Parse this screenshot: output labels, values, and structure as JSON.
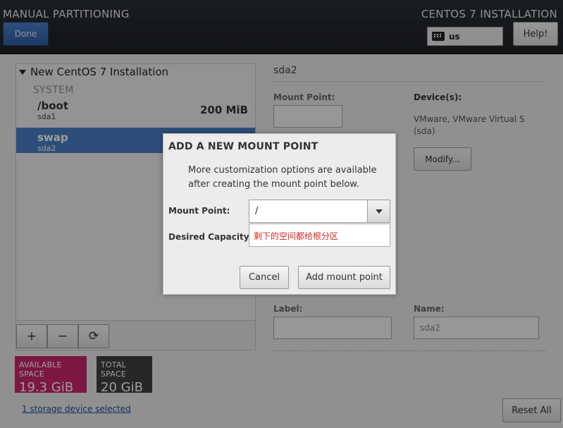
{
  "header": {
    "title": "MANUAL PARTITIONING",
    "done_label": "Done",
    "product": "CENTOS 7 INSTALLATION",
    "keyboard_layout": "us",
    "help_label": "Help!"
  },
  "left_panel": {
    "install_title": "New CentOS 7 Installation",
    "group": "SYSTEM",
    "mount_points": [
      {
        "name": "/boot",
        "device": "sda1",
        "size": "200 MiB",
        "selected": false
      },
      {
        "name": "swap",
        "device": "sda2",
        "size": "",
        "selected": true
      }
    ],
    "toolbar": {
      "add": "+",
      "remove": "−",
      "refresh": "⟳"
    }
  },
  "space": {
    "available_label": "AVAILABLE SPACE",
    "available_value": "19.3 GiB",
    "total_label": "TOTAL SPACE",
    "total_value": "20 GiB"
  },
  "storage_link": "1 storage device selected",
  "right_pane": {
    "title": "sda2",
    "mount_point_label": "Mount Point:",
    "devices_label": "Device(s):",
    "device_desc": "VMware, VMware Virtual S (sda)",
    "modify_label": "Modify...",
    "label_label": "Label:",
    "name_label": "Name:",
    "name_value": "sda2",
    "reset_label": "Reset All"
  },
  "dialog": {
    "title": "ADD A NEW MOUNT POINT",
    "description": "More customization options are available after creating the mount point below.",
    "mount_point_label": "Mount Point:",
    "mount_point_value": "/",
    "capacity_label": "Desired Capacity:",
    "capacity_value": "剩下的空间都给根分区",
    "cancel_label": "Cancel",
    "add_label": "Add mount point"
  },
  "colors": {
    "available": "#c8256d",
    "total": "#404040",
    "selected_row": "#4a7fc2",
    "capacity_text": "#d42a2a"
  }
}
